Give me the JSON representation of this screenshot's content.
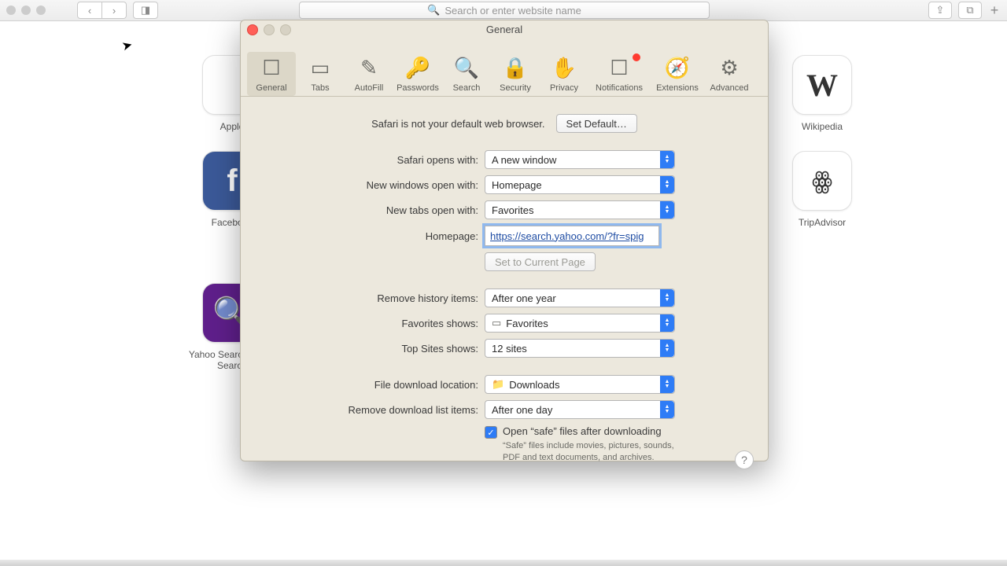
{
  "safari": {
    "address_placeholder": "Search or enter website name",
    "favorites": [
      {
        "label": "Apple",
        "glyph": ""
      },
      {
        "label": "Wikipedia",
        "glyph": "W"
      },
      {
        "label": "Facebook",
        "glyph": "f"
      },
      {
        "label": "TripAdvisor",
        "glyph": "ꙮ"
      },
      {
        "label": "Yahoo Search - Web Search",
        "glyph": "🔍"
      }
    ]
  },
  "prefs": {
    "title": "General",
    "tabs": [
      "General",
      "Tabs",
      "AutoFill",
      "Passwords",
      "Search",
      "Security",
      "Privacy",
      "Notifications",
      "Extensions",
      "Advanced"
    ],
    "default_msg": "Safari is not your default web browser.",
    "set_default": "Set Default…",
    "labels": {
      "opens_with": "Safari opens with:",
      "new_windows": "New windows open with:",
      "new_tabs": "New tabs open with:",
      "homepage": "Homepage:",
      "set_current": "Set to Current Page",
      "remove_history": "Remove history items:",
      "fav_shows": "Favorites shows:",
      "top_sites": "Top Sites shows:",
      "dl_location": "File download location:",
      "remove_dl": "Remove download list items:",
      "open_safe": "Open “safe” files after downloading",
      "safe_hint": "“Safe” files include movies, pictures, sounds, PDF and text documents, and archives."
    },
    "values": {
      "opens_with": "A new window",
      "new_windows": "Homepage",
      "new_tabs": "Favorites",
      "homepage": "https://search.yahoo.com/?fr=spig",
      "remove_history": "After one year",
      "fav_shows": "Favorites",
      "top_sites": "12 sites",
      "dl_location": "Downloads",
      "remove_dl": "After one day"
    }
  }
}
